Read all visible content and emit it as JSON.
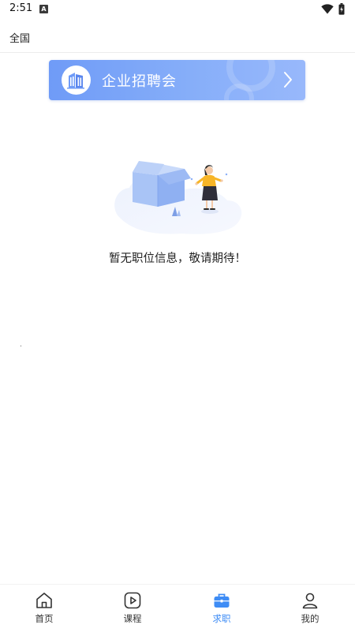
{
  "status_bar": {
    "time": "2:51",
    "notification_badge": "A",
    "wifi_icon": "wifi-icon",
    "battery_icon": "battery-icon"
  },
  "topbar": {
    "location": "全国"
  },
  "banner": {
    "title": "企业招聘会",
    "icon": "building-icon",
    "chevron": "chevron-right-icon"
  },
  "empty_state": {
    "message": "暂无职位信息，敬请期待！",
    "illustration": "empty-box-illustration"
  },
  "bottom_nav": {
    "active_color": "#3e8cf5",
    "items": [
      {
        "label": "首页",
        "icon": "home-icon",
        "active": false
      },
      {
        "label": "课程",
        "icon": "play-icon",
        "active": false
      },
      {
        "label": "求职",
        "icon": "briefcase-icon",
        "active": true
      },
      {
        "label": "我的",
        "icon": "user-icon",
        "active": false
      }
    ]
  }
}
